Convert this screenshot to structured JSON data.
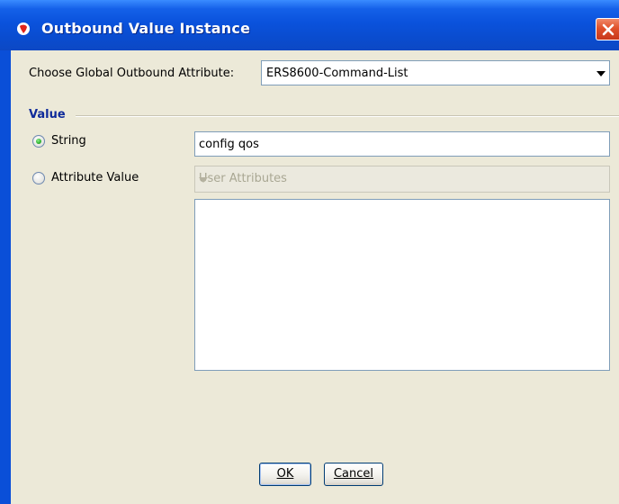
{
  "window": {
    "title": "Outbound Value Instance",
    "title_icon": "app-logo-icon",
    "close_icon": "close-icon"
  },
  "form": {
    "attribute_label": "Choose Global Outbound Attribute:",
    "attribute_value": "ERS8600-Command-List",
    "group_title": "Value",
    "string_label": "String",
    "string_value": "config qos",
    "string_selected": true,
    "attribute_value_label": "Attribute Value",
    "attribute_value_selected": false,
    "user_attributes_placeholder": "User Attributes",
    "attribute_text": ""
  },
  "buttons": {
    "ok": "OK",
    "cancel": "Cancel"
  },
  "colors": {
    "titlebar": "#0a52dc",
    "dialog_bg": "#ece9d8",
    "group_title": "#0e2a9a",
    "close_button": "#e0512b"
  }
}
